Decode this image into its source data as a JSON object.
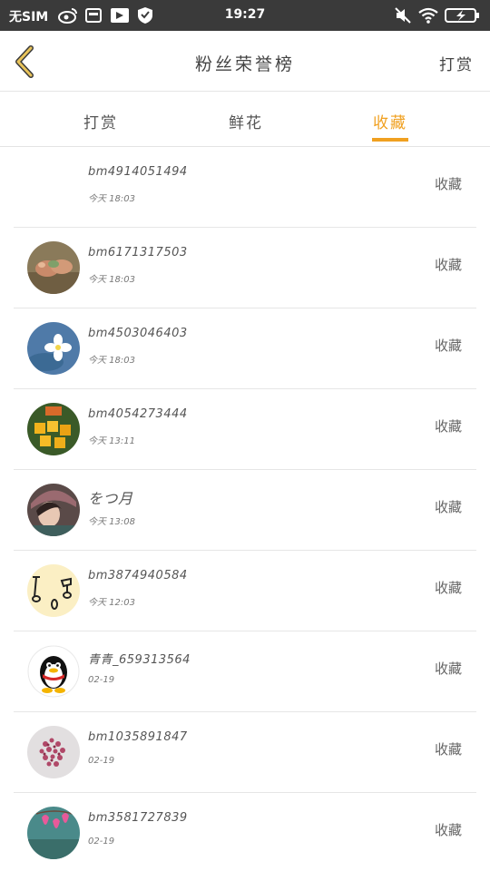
{
  "status_bar": {
    "sim": "无SIM",
    "time": "19:27"
  },
  "header": {
    "title": "粉丝荣誉榜",
    "action_label": "打赏"
  },
  "tabs": [
    {
      "label": "打赏",
      "active": false
    },
    {
      "label": "鲜花",
      "active": false
    },
    {
      "label": "收藏",
      "active": true
    }
  ],
  "colors": {
    "accent": "#f0a020",
    "status_bar_bg": "#3a3a3a"
  },
  "rows": [
    {
      "name": "bm4914051494",
      "time": "今天 18:03",
      "action": "收藏",
      "avatar": "none"
    },
    {
      "name": "bm6171317503",
      "time": "今天 18:03",
      "action": "收藏",
      "avatar": "food-photo"
    },
    {
      "name": "bm4503046403",
      "time": "今天 18:03",
      "action": "收藏",
      "avatar": "flower-photo"
    },
    {
      "name": "bm4054273444",
      "time": "今天 13:11",
      "action": "收藏",
      "avatar": "fruit-photo"
    },
    {
      "name": "をつ月",
      "time": "今天 13:08",
      "action": "收藏",
      "avatar": "person-photo"
    },
    {
      "name": "bm3874940584",
      "time": "今天 12:03",
      "action": "收藏",
      "avatar": "cartoon-face"
    },
    {
      "name": "青青_659313564",
      "time": "02-19",
      "action": "收藏",
      "avatar": "penguin"
    },
    {
      "name": "bm1035891847",
      "time": "02-19",
      "action": "收藏",
      "avatar": "pink-flowers-photo"
    },
    {
      "name": "bm3581727839",
      "time": "02-19",
      "action": "收藏",
      "avatar": "pink-blossom-photo"
    }
  ]
}
